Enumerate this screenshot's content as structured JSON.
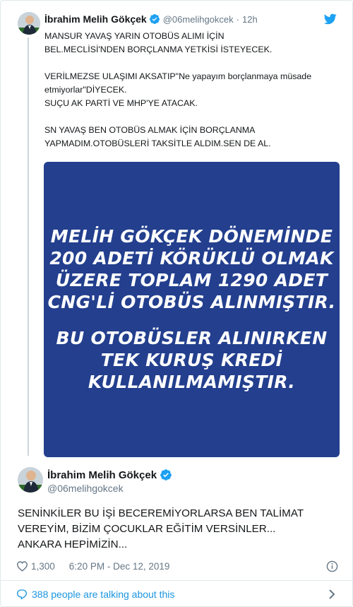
{
  "parent_tweet": {
    "author_name": "İbrahim Melih Gökçek",
    "handle": "@06melihgokcek",
    "separator": "·",
    "time": "12h",
    "verified": true,
    "lines": [
      "MANSUR YAVAŞ YARIN OTOBÜS ALIMI İÇİN",
      "BEL.MECLİSİ'NDEN BORÇLANMA YETKİSİ İSTEYECEK.",
      "",
      "VERİLMEZSE ULAŞIMI AKSATIP\"Ne yapayım borçlanmaya müsade",
      "etmiyorlar\"DİYECEK.",
      "SUÇU AK PARTİ VE MHP'YE ATACAK.",
      "",
      "SN YAVAŞ BEN OTOBÜS ALMAK İÇİN BORÇLANMA",
      "YAPMADIM.OTOBÜSLERİ TAKSİTLE ALDIM.SEN DE AL."
    ],
    "media": {
      "block1": [
        "MELİH GÖKÇEK DÖNEMİNDE",
        "200 ADETİ KÖRÜKLÜ OLMAK",
        "ÜZERE TOPLAM 1290 ADET",
        "CNG'Lİ OTOBÜS ALINMIŞTIR."
      ],
      "block2": [
        "BU OTOBÜSLER ALINIRKEN",
        "TEK KURUŞ KREDİ",
        "KULLANILMAMIŞTIR."
      ],
      "background_color": "#233f8e"
    }
  },
  "main_tweet": {
    "author_name": "İbrahim Melih Gökçek",
    "handle": "@06melihgokcek",
    "verified": true,
    "lines": [
      "SENİNKİLER BU İŞİ BECEREMİYORLARSA BEN TALİMAT",
      "VEREYİM, BİZİM ÇOCUKLAR EĞİTİM VERSİNLER...",
      "ANKARA HEPİMİZİN..."
    ],
    "likes": "1,300",
    "timestamp": "6:20 PM - Dec 12, 2019"
  },
  "footer": {
    "talking_text": "388 people are talking about this"
  },
  "colors": {
    "twitter_blue": "#1da1f2",
    "link_blue": "#1b95e0",
    "secondary_text": "#657786",
    "border": "#e1e8ed"
  },
  "icons": {
    "verified": "verified-badge-icon",
    "brand": "twitter-bird-icon",
    "like": "heart-icon",
    "info": "info-icon",
    "conversation": "speech-bubble-icon",
    "more": "chevron-right-icon"
  }
}
